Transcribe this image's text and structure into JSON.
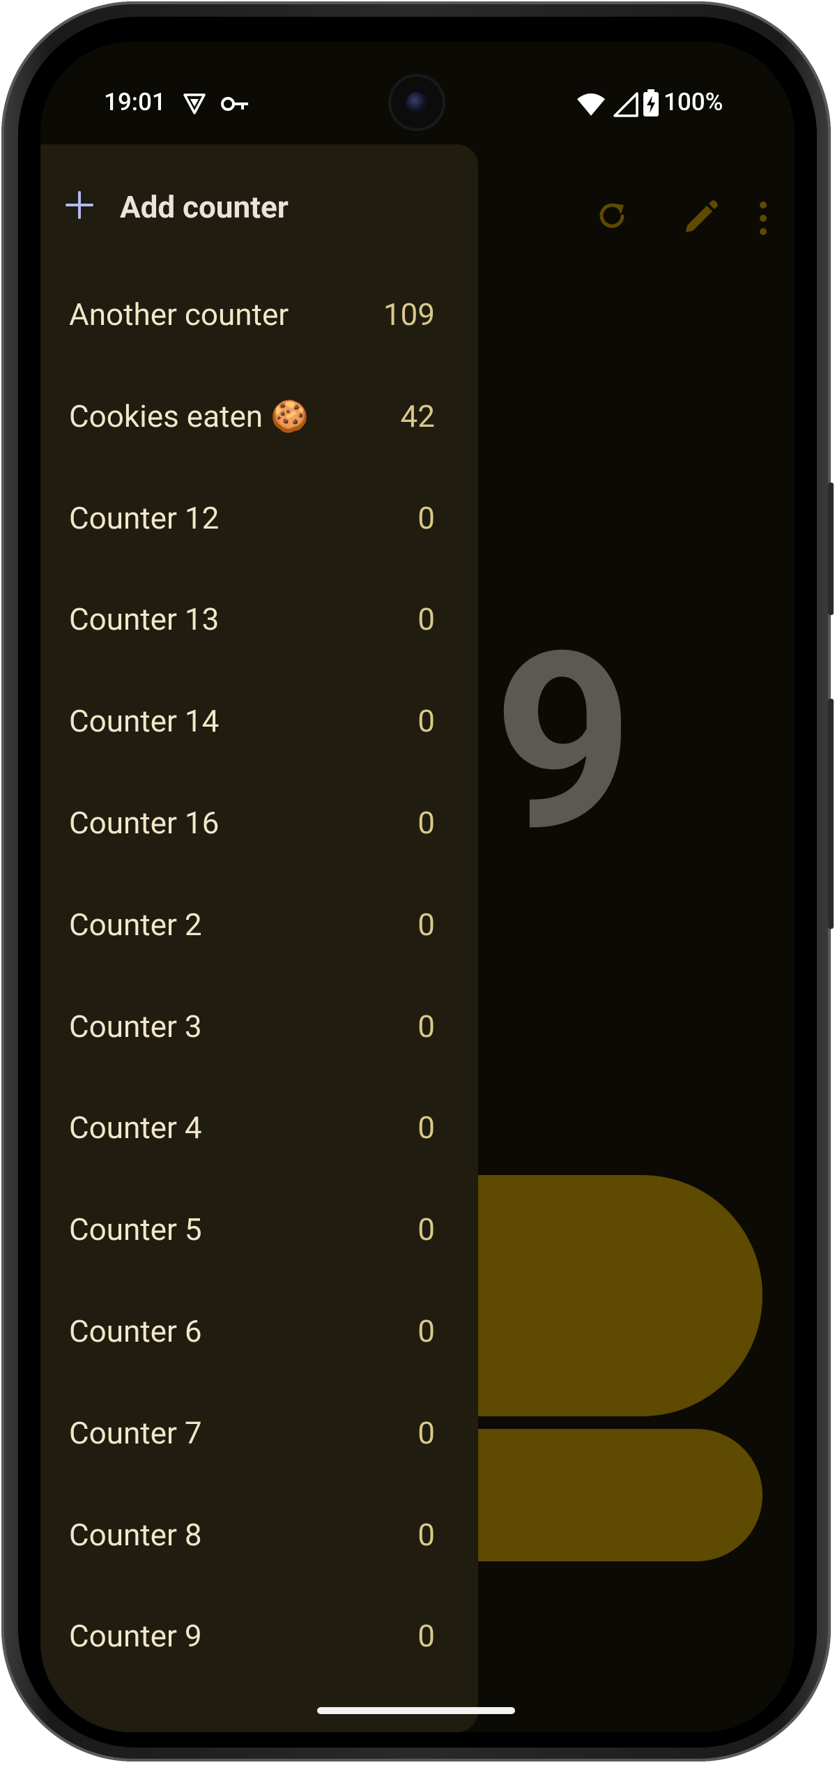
{
  "status_bar": {
    "time": "19:01",
    "battery_percent": "100%",
    "icons": [
      "vpn-shield-icon",
      "key-icon",
      "wifi-icon",
      "cellular-signal-icon",
      "battery-charging-icon"
    ]
  },
  "toolbar": {
    "icons": [
      "reset-icon",
      "edit-icon",
      "more-options-icon"
    ],
    "accent_color": "#5e4a00"
  },
  "main": {
    "visible_count_digit": "9"
  },
  "drawer": {
    "add_label": "Add counter",
    "items": [
      {
        "name": "Another counter",
        "count": "109"
      },
      {
        "name": "Cookies eaten 🍪",
        "count": "42"
      },
      {
        "name": "Counter 12",
        "count": "0"
      },
      {
        "name": "Counter 13",
        "count": "0"
      },
      {
        "name": "Counter 14",
        "count": "0"
      },
      {
        "name": "Counter 16",
        "count": "0"
      },
      {
        "name": "Counter 2",
        "count": "0"
      },
      {
        "name": "Counter 3",
        "count": "0"
      },
      {
        "name": "Counter 4",
        "count": "0"
      },
      {
        "name": "Counter 5",
        "count": "0"
      },
      {
        "name": "Counter 6",
        "count": "0"
      },
      {
        "name": "Counter 7",
        "count": "0"
      },
      {
        "name": "Counter 8",
        "count": "0"
      },
      {
        "name": "Counter 9",
        "count": "0"
      }
    ]
  }
}
